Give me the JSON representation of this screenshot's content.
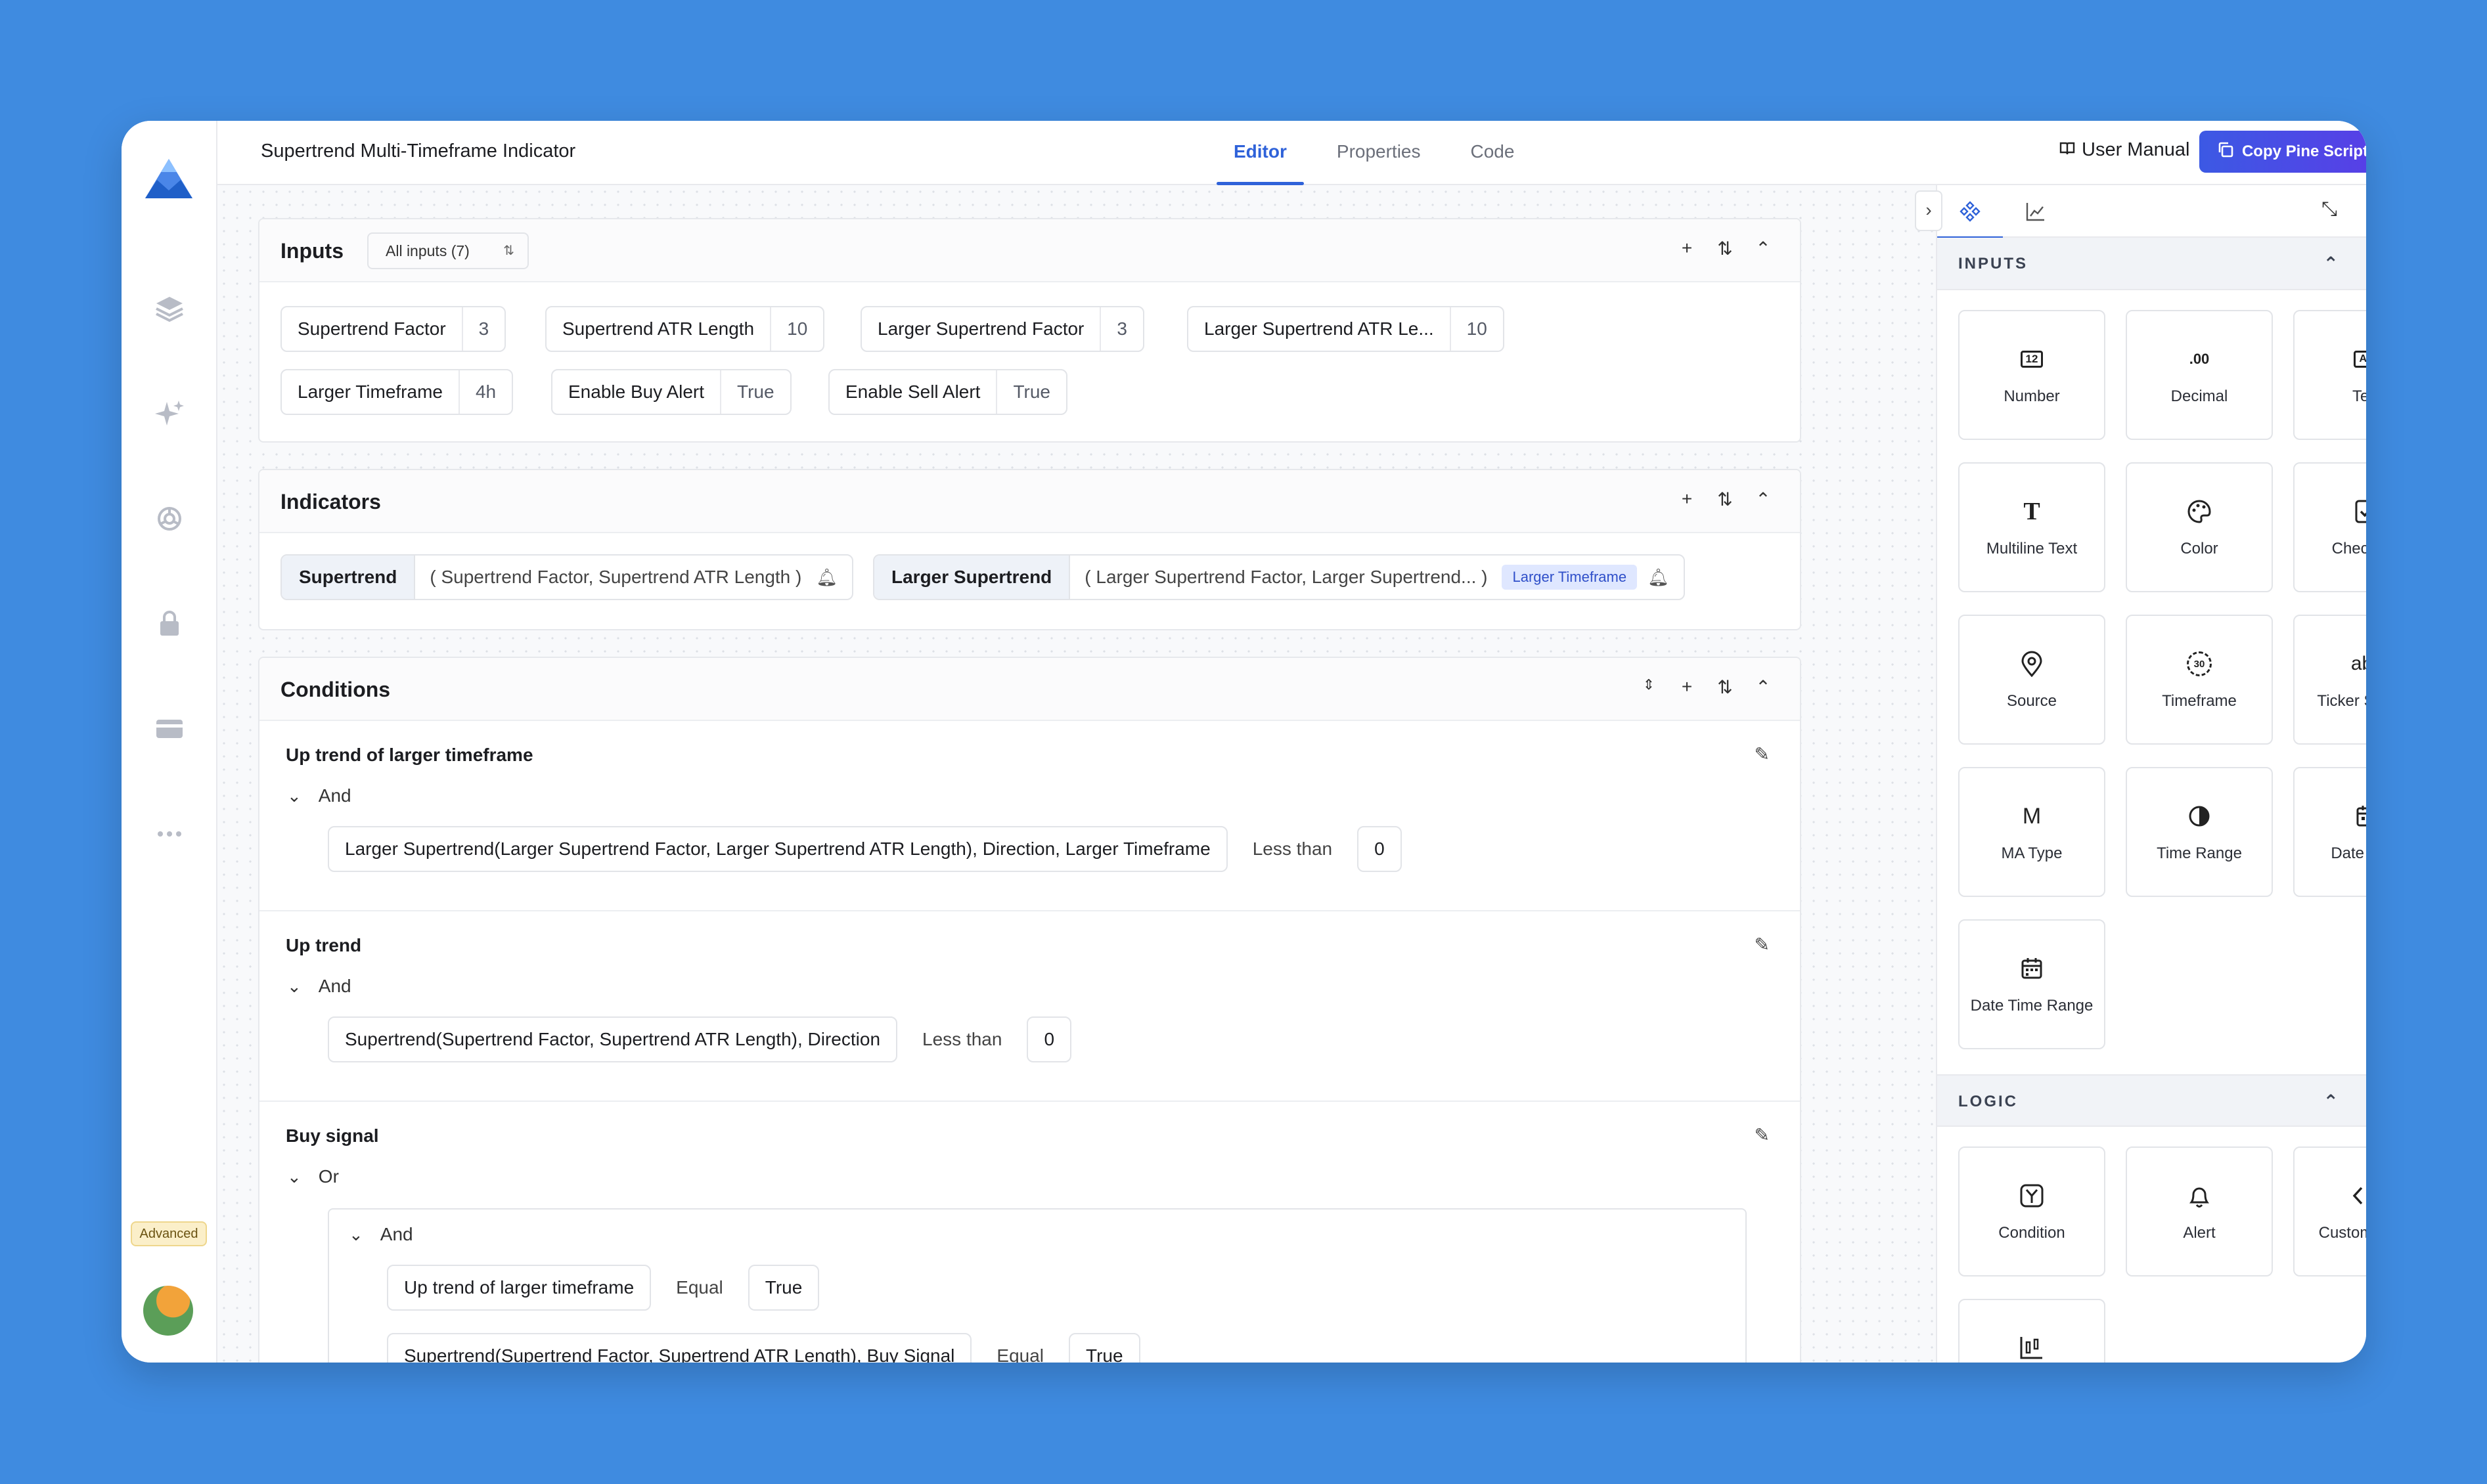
{
  "header": {
    "title": "Supertrend Multi-Timeframe Indicator",
    "tabs": [
      {
        "label": "Editor",
        "active": true
      },
      {
        "label": "Properties",
        "active": false
      },
      {
        "label": "Code",
        "active": false
      }
    ],
    "user_manual": "User Manual",
    "copy_button": "Copy Pine Script",
    "more": "···"
  },
  "sidebar": {
    "icons": [
      "layers-icon",
      "sparkle-icon",
      "openai-icon",
      "lock-icon",
      "card-icon",
      "more-icon"
    ],
    "badge": "Advanced"
  },
  "inputs_panel": {
    "title": "Inputs",
    "filter": "All inputs (7)",
    "items": [
      {
        "label": "Supertrend Factor",
        "value": "3"
      },
      {
        "label": "Supertrend ATR Length",
        "value": "10"
      },
      {
        "label": "Larger Supertrend Factor",
        "value": "3"
      },
      {
        "label": "Larger Supertrend ATR Le...",
        "value": "10"
      },
      {
        "label": "Larger Timeframe",
        "value": "4h"
      },
      {
        "label": "Enable Buy Alert",
        "value": "True"
      },
      {
        "label": "Enable Sell Alert",
        "value": "True"
      }
    ]
  },
  "indicators_panel": {
    "title": "Indicators",
    "items": [
      {
        "name": "Supertrend",
        "params": "( Supertrend Factor, Supertrend ATR Length )",
        "tag": ""
      },
      {
        "name": "Larger Supertrend",
        "params": "( Larger Supertrend Factor, Larger Supertrend... )",
        "tag": "Larger Timeframe"
      }
    ]
  },
  "conditions_panel": {
    "title": "Conditions",
    "items": [
      {
        "title": "Up trend of larger timeframe",
        "op": "And",
        "lhs": "Larger Supertrend(Larger Supertrend Factor, Larger Supertrend ATR Length), Direction, Larger Timeframe",
        "cmp": "Less than",
        "rhs": "0"
      },
      {
        "title": "Up trend",
        "op": "And",
        "lhs": "Supertrend(Supertrend Factor, Supertrend ATR Length), Direction",
        "cmp": "Less than",
        "rhs": "0"
      },
      {
        "title": "Buy signal",
        "op": "Or",
        "nested_op": "And",
        "rows": [
          {
            "lhs": "Up trend of larger timeframe",
            "cmp": "Equal",
            "rhs": "True"
          },
          {
            "lhs": "Supertrend(Supertrend Factor, Supertrend ATR Length), Buy Signal",
            "cmp": "Equal",
            "rhs": "True"
          }
        ]
      }
    ]
  },
  "right_panel": {
    "inputs_section": "INPUTS",
    "input_tiles": [
      "Number",
      "Decimal",
      "Text",
      "Multiline Text",
      "Color",
      "Checkbox",
      "Source",
      "Timeframe",
      "Ticker Symbol",
      "MA Type",
      "Time Range",
      "Date Time",
      "Date Time Range"
    ],
    "logic_section": "LOGIC",
    "logic_tiles": [
      "Condition",
      "Alert",
      "Custom Code"
    ],
    "glyphs": {
      "number": "12",
      "decimal": ".00",
      "text": "AB",
      "multiline": "T",
      "timeframe": "30",
      "ticker": "abc",
      "ma": "M"
    }
  }
}
